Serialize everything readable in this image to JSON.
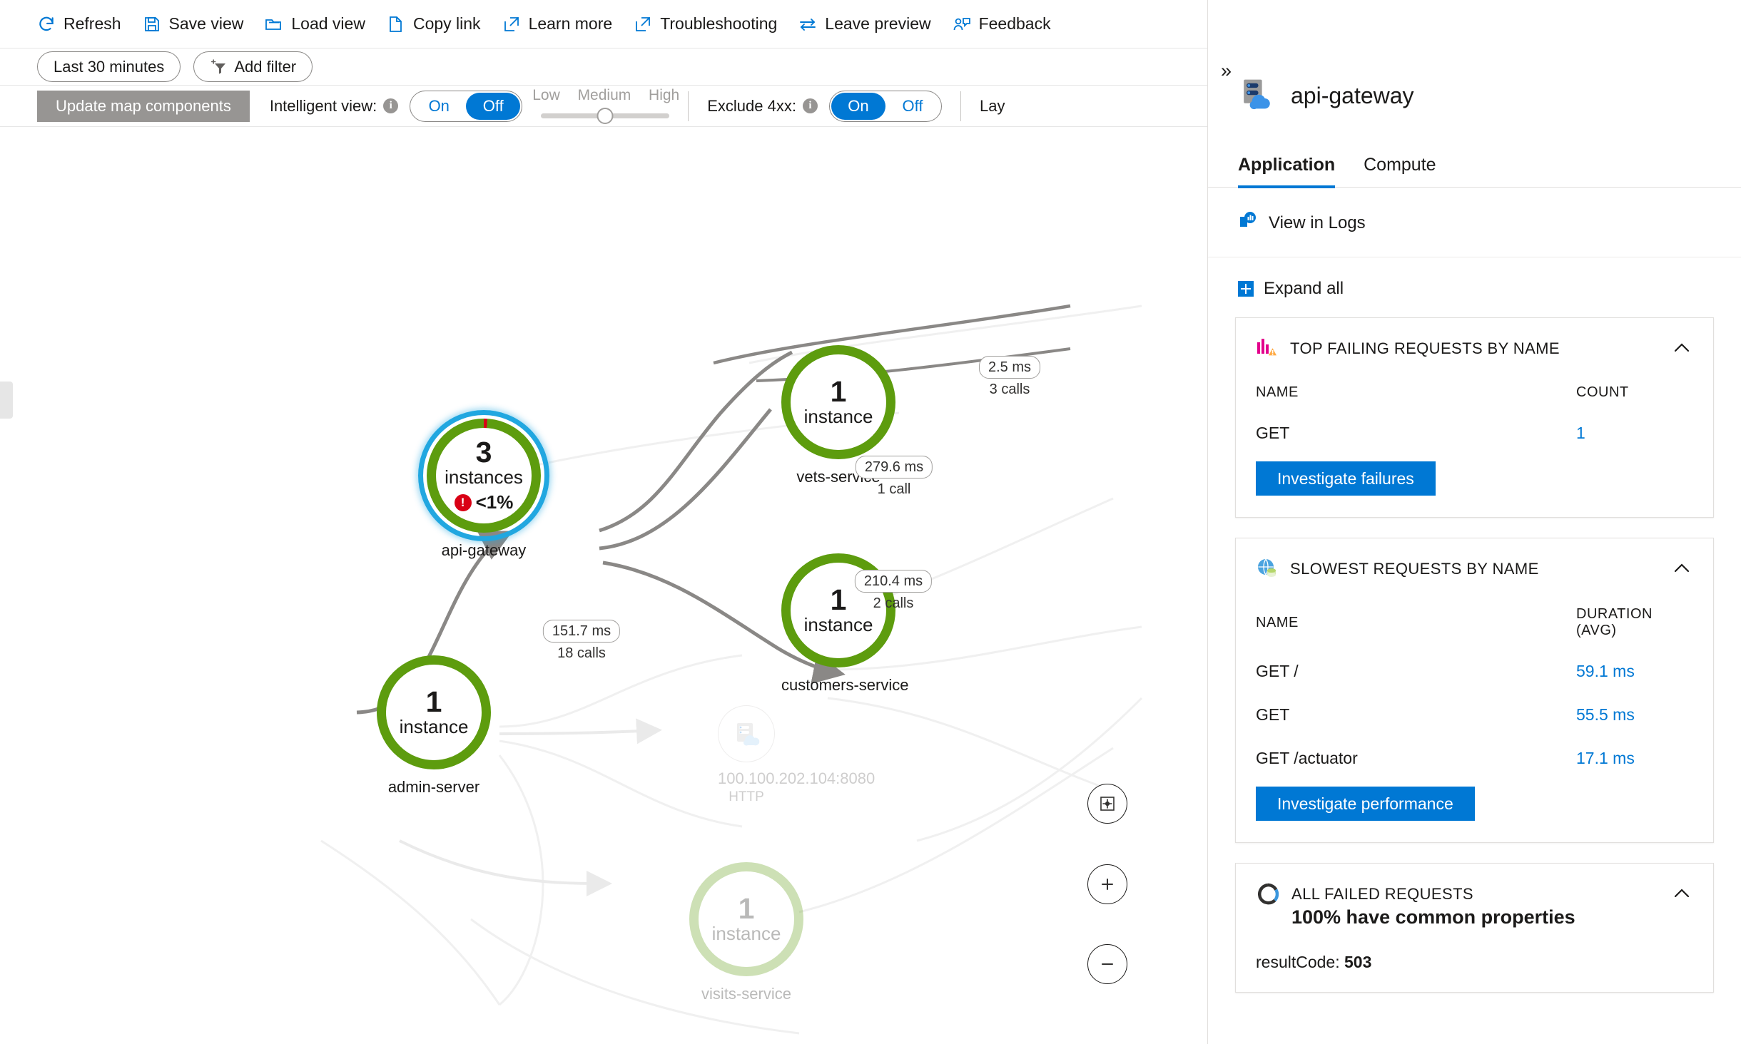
{
  "toolbar": {
    "buttons": [
      {
        "label": "Refresh",
        "icon": "refresh-icon"
      },
      {
        "label": "Save view",
        "icon": "save-icon"
      },
      {
        "label": "Load view",
        "icon": "folder-open-icon"
      },
      {
        "label": "Copy link",
        "icon": "copy-link-icon"
      },
      {
        "label": "Learn more",
        "icon": "external-link-icon"
      },
      {
        "label": "Troubleshooting",
        "icon": "external-link-icon"
      },
      {
        "label": "Leave preview",
        "icon": "swap-arrows-icon"
      },
      {
        "label": "Feedback",
        "icon": "feedback-person-icon"
      }
    ]
  },
  "filters": {
    "time_range": "Last 30 minutes",
    "add_filter": "Add filter",
    "add_filter_icon": "add-filter-funnel-icon"
  },
  "controls": {
    "update_button": "Update map components",
    "intelligent_view": {
      "label": "Intelligent view:",
      "info_icon": "info-icon",
      "on": "On",
      "off": "Off",
      "selected": "Off"
    },
    "sensitivity": {
      "low": "Low",
      "medium": "Medium",
      "high": "High",
      "value": "Medium"
    },
    "exclude_4xx": {
      "label": "Exclude 4xx:",
      "info_icon": "info-icon",
      "on": "On",
      "off": "Off",
      "selected": "On"
    },
    "layout_label": "Lay"
  },
  "map": {
    "zoom_controls": {
      "fit": "fit-to-screen-icon",
      "zoom_in": "plus-icon",
      "zoom_out": "minus-icon"
    },
    "nodes": [
      {
        "id": "api-gateway",
        "label": "api-gateway",
        "count": "3",
        "unit": "instances",
        "error_rate": "<1%",
        "selected": true
      },
      {
        "id": "vets-service",
        "label": "vets-service",
        "count": "1",
        "unit": "instance",
        "selected": false
      },
      {
        "id": "customers-service",
        "label": "customers-service",
        "count": "1",
        "unit": "instance",
        "selected": false
      },
      {
        "id": "admin-server",
        "label": "admin-server",
        "count": "1",
        "unit": "instance",
        "selected": false
      },
      {
        "id": "visits-service",
        "label": "visits-service",
        "count": "1",
        "unit": "instance",
        "selected": false,
        "faded": true
      }
    ],
    "dependency_node": {
      "name": "100.100.202.104:8080",
      "type": "HTTP",
      "icon": "server-cloud-icon"
    },
    "edges": [
      {
        "id": "gw-vets",
        "duration": "2.5 ms",
        "calls": "3 calls"
      },
      {
        "id": "gw-vets-2",
        "duration": "279.6 ms",
        "calls": "1 call"
      },
      {
        "id": "gw-customers",
        "duration": "210.4 ms",
        "calls": "2 calls"
      },
      {
        "id": "admin-gw",
        "duration": "151.7 ms",
        "calls": "18 calls"
      }
    ]
  },
  "details_panel": {
    "collapse_icon": "chevron-double-right-icon",
    "node_icon": "server-cloud-icon",
    "title": "api-gateway",
    "tabs": [
      {
        "label": "Application",
        "active": true
      },
      {
        "label": "Compute",
        "active": false
      }
    ],
    "view_in_logs": "View in Logs",
    "view_in_logs_icon": "logs-icon",
    "expand_all": "Expand all",
    "expand_all_icon": "plus-box-icon",
    "cards": [
      {
        "id": "top-failing-requests",
        "icon": "failing-chart-icon",
        "title": "TOP FAILING REQUESTS BY NAME",
        "caret_icon": "chevron-up-icon",
        "columns": [
          "NAME",
          "COUNT"
        ],
        "rows": [
          {
            "name": "GET",
            "value": "1"
          }
        ],
        "button": "Investigate failures"
      },
      {
        "id": "slowest-requests",
        "icon": "performance-globe-icon",
        "title": "SLOWEST REQUESTS BY NAME",
        "caret_icon": "chevron-up-icon",
        "columns": [
          "NAME",
          "DURATION (AVG)"
        ],
        "rows": [
          {
            "name": "GET /",
            "value": "59.1 ms"
          },
          {
            "name": "GET",
            "value": "55.5 ms"
          },
          {
            "name": "GET /actuator",
            "value": "17.1 ms"
          }
        ],
        "button": "Investigate performance"
      },
      {
        "id": "all-failed-requests",
        "icon": "donut-spinner-icon",
        "title": "ALL FAILED REQUESTS",
        "subtitle": "100% have common properties",
        "caret_icon": "chevron-up-icon",
        "footer_label": "resultCode:",
        "footer_value": "503"
      }
    ]
  },
  "colors": {
    "accent": "#0078d4",
    "node_green": "#5d9c0e",
    "selected_ring": "#21a7e0",
    "error_red": "#d90015",
    "update_button_bg": "#979593"
  }
}
